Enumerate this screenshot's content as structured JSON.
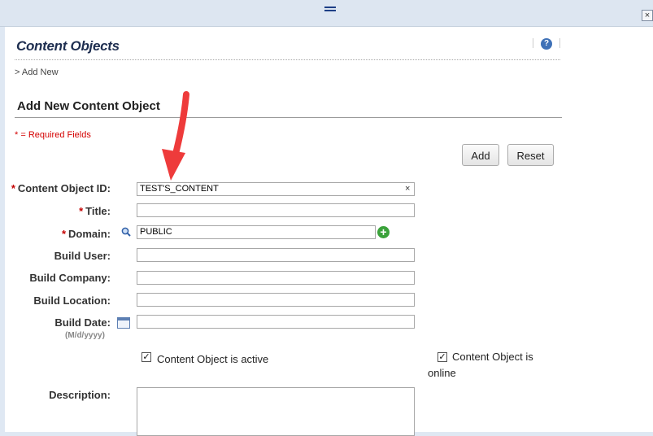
{
  "window": {
    "close_glyph": "×"
  },
  "header": {
    "title": "Content Objects",
    "help_glyph": "?"
  },
  "breadcrumb": "> Add New",
  "form": {
    "section_title": "Add New Content Object",
    "required_note": "* = Required Fields",
    "buttons": {
      "add": "Add",
      "reset": "Reset"
    },
    "fields": {
      "content_object_id": {
        "label": "Content Object ID:",
        "value": "TEST'S_CONTENT",
        "required": true,
        "clear_glyph": "×"
      },
      "title": {
        "label": "Title:",
        "value": "",
        "required": true
      },
      "domain": {
        "label": "Domain:",
        "value": "PUBLIC",
        "required": true,
        "add_glyph": "+"
      },
      "build_user": {
        "label": "Build User:",
        "value": ""
      },
      "build_company": {
        "label": "Build Company:",
        "value": ""
      },
      "build_location": {
        "label": "Build Location:",
        "value": ""
      },
      "build_date": {
        "label": "Build Date:",
        "value": "",
        "hint": "(M/d/yyyy)"
      },
      "description": {
        "label": "Description:",
        "value": ""
      }
    },
    "checkboxes": {
      "active": {
        "label": "Content Object is active",
        "checked": true
      },
      "online": {
        "label_line1": "Content Object is",
        "label_line2": "online",
        "checked": true
      }
    },
    "required_star": "*",
    "check_glyph": "✓"
  },
  "colors": {
    "required": "#d40000",
    "arrow": "#ee3b3b",
    "title": "#1e2e50",
    "accent": "#3f71b7"
  }
}
